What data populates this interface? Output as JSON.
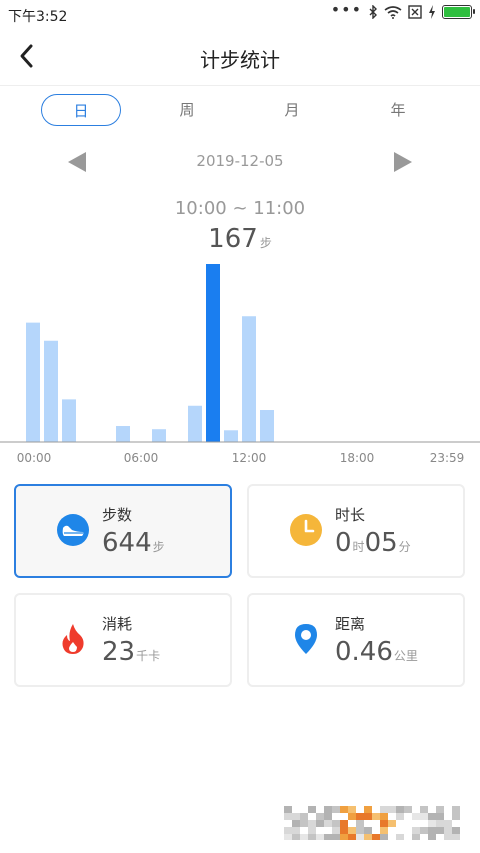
{
  "status_bar": {
    "time": "下午3:52",
    "battery_color": "#2fbf3f"
  },
  "app_bar": {
    "title": "计步统计",
    "back_icon": "chevron-left-icon"
  },
  "tabs": [
    {
      "label": "日",
      "active": true
    },
    {
      "label": "周",
      "active": false
    },
    {
      "label": "月",
      "active": false
    },
    {
      "label": "年",
      "active": false
    }
  ],
  "date_nav": {
    "date": "2019-12-05",
    "prev_icon": "triangle-left-icon",
    "next_icon": "triangle-right-icon"
  },
  "selection": {
    "range": "10:00 ~ 11:00",
    "steps": "167",
    "unit": "步"
  },
  "chart_data": {
    "type": "bar",
    "x_ticks": [
      "00:00",
      "06:00",
      "12:00",
      "18:00",
      "23:59"
    ],
    "categories": [
      "00:00",
      "01:00",
      "02:00",
      "03:00",
      "04:00",
      "05:00",
      "06:00",
      "07:00",
      "08:00",
      "09:00",
      "10:00",
      "11:00",
      "12:00",
      "13:00",
      "14:00",
      "15:00",
      "16:00",
      "17:00",
      "18:00",
      "19:00",
      "20:00",
      "21:00",
      "22:00",
      "23:00"
    ],
    "values": [
      112,
      95,
      40,
      0,
      0,
      15,
      0,
      12,
      0,
      34,
      167,
      11,
      118,
      30,
      0,
      0,
      0,
      0,
      0,
      0,
      0,
      0,
      0,
      0
    ],
    "highlight_index": 10,
    "ylim": [
      0,
      167
    ],
    "colors": {
      "bar": "#b5d6fb",
      "highlight": "#1a7ef0",
      "axis": "#999999"
    }
  },
  "cards": [
    {
      "label": "步数",
      "parts": [
        {
          "v": "644",
          "u": "步"
        }
      ],
      "icon": "sneaker-icon",
      "active": true
    },
    {
      "label": "时长",
      "parts": [
        {
          "v": "0",
          "u": "时"
        },
        {
          "v": "05",
          "u": "分"
        }
      ],
      "icon": "clock-icon",
      "active": false
    },
    {
      "label": "消耗",
      "parts": [
        {
          "v": "23",
          "u": "千卡"
        }
      ],
      "icon": "flame-icon",
      "active": false
    },
    {
      "label": "距离",
      "parts": [
        {
          "v": "0.46",
          "u": "公里"
        }
      ],
      "icon": "location-pin-icon",
      "active": false
    }
  ],
  "colors": {
    "accent": "#2c7fe0"
  }
}
